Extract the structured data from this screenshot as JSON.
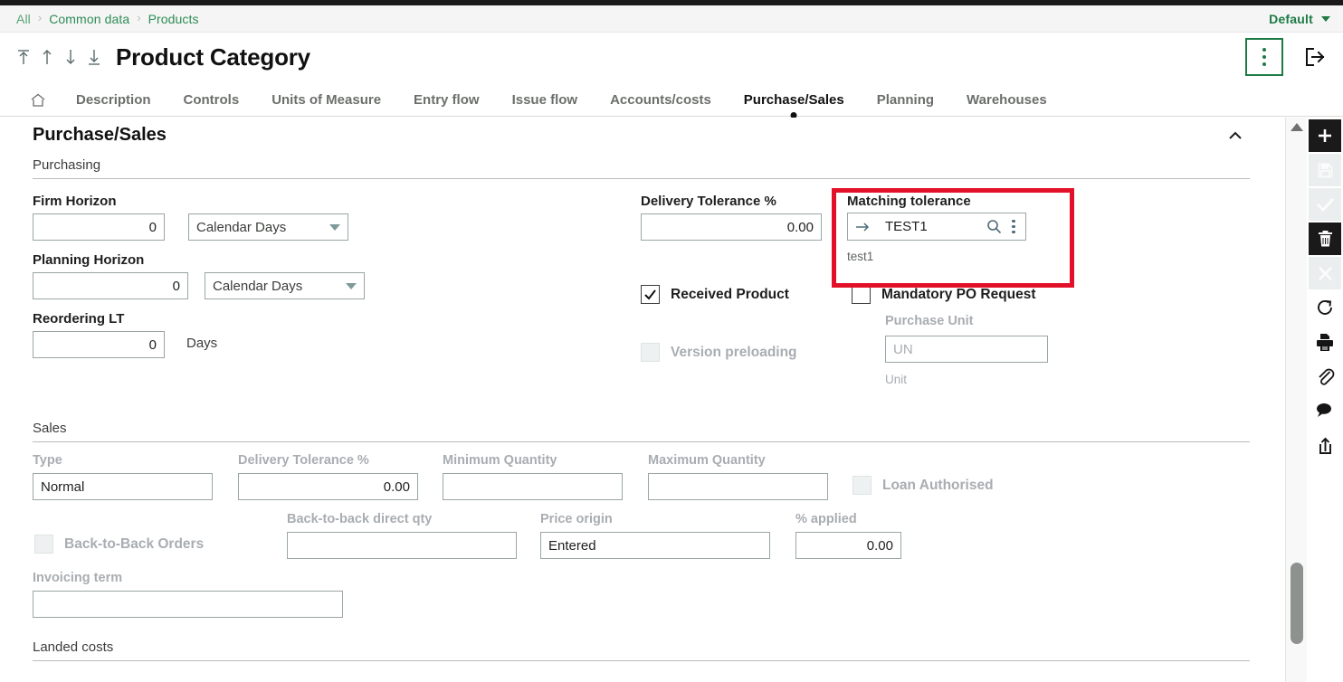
{
  "breadcrumb": {
    "items": [
      "All",
      "Common data",
      "Products"
    ],
    "separator": "›"
  },
  "topbar": {
    "profile_label": "Default",
    "profile_caret_icon": "chevron-down-icon",
    "kebab_icon": "more-vertical-icon",
    "logout_icon": "logout-icon"
  },
  "title": {
    "text": "Product Category",
    "nav": [
      {
        "name": "first-record",
        "icon": "arrow-up-to-line-icon"
      },
      {
        "name": "previous-record",
        "icon": "arrow-up-icon"
      },
      {
        "name": "next-record",
        "icon": "arrow-down-icon"
      },
      {
        "name": "last-record",
        "icon": "arrow-down-to-line-icon"
      }
    ]
  },
  "tabs": {
    "home_icon": "home-icon",
    "items": [
      {
        "label": "Description",
        "active": false
      },
      {
        "label": "Controls",
        "active": false
      },
      {
        "label": "Units of Measure",
        "active": false
      },
      {
        "label": "Entry flow",
        "active": false
      },
      {
        "label": "Issue flow",
        "active": false
      },
      {
        "label": "Accounts/costs",
        "active": false
      },
      {
        "label": "Purchase/Sales",
        "active": true
      },
      {
        "label": "Planning",
        "active": false
      },
      {
        "label": "Warehouses",
        "active": false
      }
    ]
  },
  "panel": {
    "title": "Purchase/Sales",
    "collapse_icon": "chevron-up-icon"
  },
  "purchasing": {
    "section_label": "Purchasing",
    "firm_horizon": {
      "label": "Firm Horizon",
      "value": "0",
      "unit_value": "Calendar Days"
    },
    "planning_horizon": {
      "label": "Planning Horizon",
      "value": "0",
      "unit_value": "Calendar Days"
    },
    "reordering_lt": {
      "label": "Reordering LT",
      "value": "0",
      "suffix": "Days"
    },
    "delivery_tolerance": {
      "label": "Delivery Tolerance %",
      "value": "0.00"
    },
    "matching_tolerance": {
      "label": "Matching tolerance",
      "value": "TEST1",
      "caption": "test1",
      "arrow_icon": "arrow-right-icon",
      "search_icon": "search-icon",
      "kebab_icon": "more-vertical-icon",
      "highlight_color": "#e3102a"
    },
    "received_product": {
      "label": "Received Product",
      "checked": true
    },
    "mandatory_po_request": {
      "label": "Mandatory PO Request",
      "checked": false
    },
    "version_preloading": {
      "label": "Version preloading",
      "checked": false,
      "disabled": true
    },
    "purchase_unit": {
      "label": "Purchase Unit",
      "value": "UN",
      "caption": "Unit"
    }
  },
  "sales": {
    "section_label": "Sales",
    "type": {
      "label": "Type",
      "value": "Normal"
    },
    "delivery_tolerance": {
      "label": "Delivery Tolerance %",
      "value": "0.00"
    },
    "minimum_quantity": {
      "label": "Minimum Quantity",
      "value": ""
    },
    "maximum_quantity": {
      "label": "Maximum Quantity",
      "value": ""
    },
    "loan_authorised": {
      "label": "Loan Authorised",
      "checked": false,
      "disabled": true
    },
    "back_to_back_orders": {
      "label": "Back-to-Back Orders",
      "checked": false,
      "disabled": true
    },
    "back_to_back_direct_qty": {
      "label": "Back-to-back direct qty",
      "value": ""
    },
    "price_origin": {
      "label": "Price origin",
      "value": "Entered"
    },
    "percent_applied": {
      "label": "% applied",
      "value": "0.00"
    },
    "invoicing_term": {
      "label": "Invoicing term",
      "value": ""
    }
  },
  "landed": {
    "section_label": "Landed costs"
  },
  "rail": {
    "items": [
      {
        "name": "create-button",
        "icon": "plus-icon",
        "style": "sq-dark"
      },
      {
        "name": "save-button",
        "icon": "save-icon",
        "style": "sq-dis"
      },
      {
        "name": "validate-button",
        "icon": "check-icon",
        "style": "sq-dis"
      },
      {
        "name": "delete-button",
        "icon": "trash-icon",
        "style": "sq-dark"
      },
      {
        "name": "cancel-button",
        "icon": "close-icon",
        "style": "sq-dis"
      },
      {
        "name": "refresh-button",
        "icon": "refresh-icon",
        "style": "plain"
      },
      {
        "name": "print-button",
        "icon": "printer-icon",
        "style": "plain"
      },
      {
        "name": "attachment-button",
        "icon": "paperclip-icon",
        "style": "plain"
      },
      {
        "name": "comment-button",
        "icon": "comment-icon",
        "style": "plain"
      },
      {
        "name": "share-button",
        "icon": "share-icon",
        "style": "plain"
      }
    ]
  },
  "scrollbar": {
    "up_icon": "triangle-up-icon"
  }
}
